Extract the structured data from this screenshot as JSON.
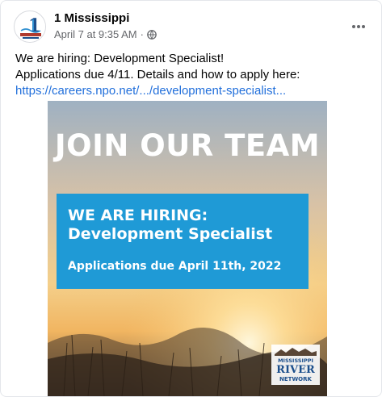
{
  "post": {
    "author": "1 Mississippi",
    "date": "April 7 at 9:35 AM",
    "separator": "·",
    "text_line1": "We are hiring: Development Specialist!",
    "text_line2": "Applications due 4/11. Details and how to apply here:",
    "link": "https://careers.npo.net/.../development-specialist...",
    "icons": [
      "avatar",
      "globe-icon",
      "more-options-icon"
    ]
  },
  "image": {
    "headline": "JOIN OUR TEAM",
    "box_line1": "WE ARE HIRING:",
    "box_line2": "Development Specialist",
    "box_line3": "Applications due April 11th, 2022",
    "logo_text": "MISSISSIPPI RIVER NETWORK",
    "box_color": "#1f9ad6"
  },
  "colors": {
    "link": "#216fdb",
    "meta": "#65676b"
  }
}
